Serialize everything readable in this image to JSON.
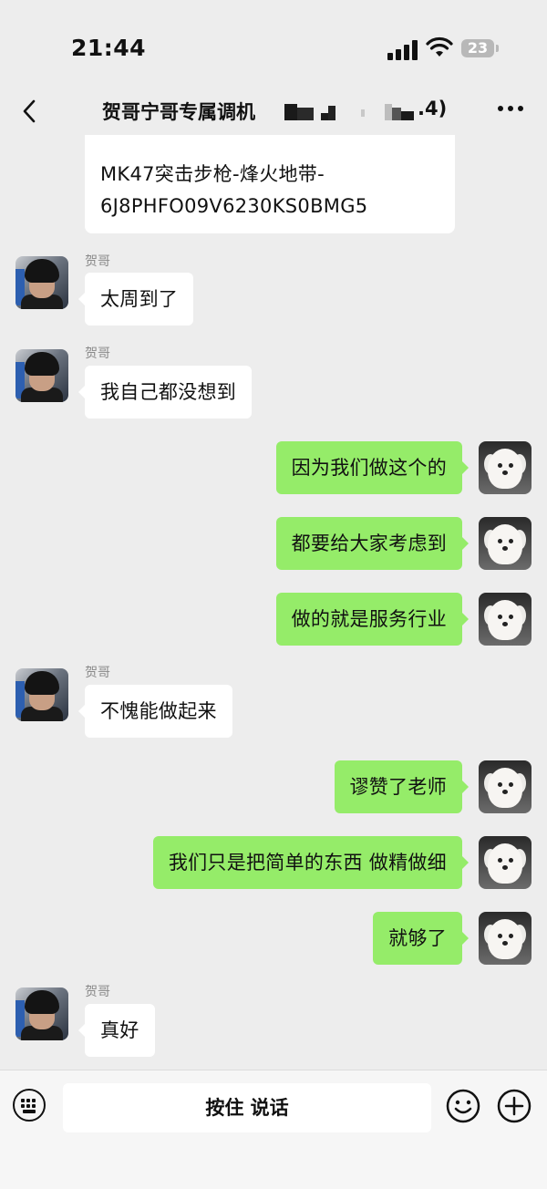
{
  "status_bar": {
    "time": "21:44",
    "battery_level": "23",
    "icons": [
      "signal-icon",
      "wifi-icon",
      "battery-icon"
    ]
  },
  "nav": {
    "title": "贺哥宁哥专属调机",
    "title_suffix": ".4)",
    "icons": [
      "back-icon",
      "more-icon"
    ]
  },
  "chat": {
    "partial_message": {
      "lines": [
        "MK47突击步枪-烽火地带-",
        "6J8PHFO09V6230KS0BMG5"
      ]
    },
    "messages": [
      {
        "side": "left",
        "sender": "贺哥",
        "text": "太周到了"
      },
      {
        "side": "left",
        "sender": "贺哥",
        "text": "我自己都没想到"
      },
      {
        "side": "right",
        "text": "因为我们做这个的"
      },
      {
        "side": "right",
        "text": "都要给大家考虑到"
      },
      {
        "side": "right",
        "text": "做的就是服务行业"
      },
      {
        "side": "left",
        "sender": "贺哥",
        "text": "不愧能做起来"
      },
      {
        "side": "right",
        "text": "谬赞了老师"
      },
      {
        "side": "right",
        "text": "我们只是把简单的东西 做精做细"
      },
      {
        "side": "right",
        "text": "就够了"
      },
      {
        "side": "left",
        "sender": "贺哥",
        "text": "真好"
      }
    ]
  },
  "input_bar": {
    "hold_to_talk_label": "按住 说话",
    "icons": [
      "keyboard-icon",
      "emoji-icon",
      "plus-icon"
    ]
  },
  "colors": {
    "background": "#ededed",
    "outgoing_bubble": "#95ec69",
    "incoming_bubble": "#ffffff",
    "sender_name": "#8a8a8a"
  }
}
